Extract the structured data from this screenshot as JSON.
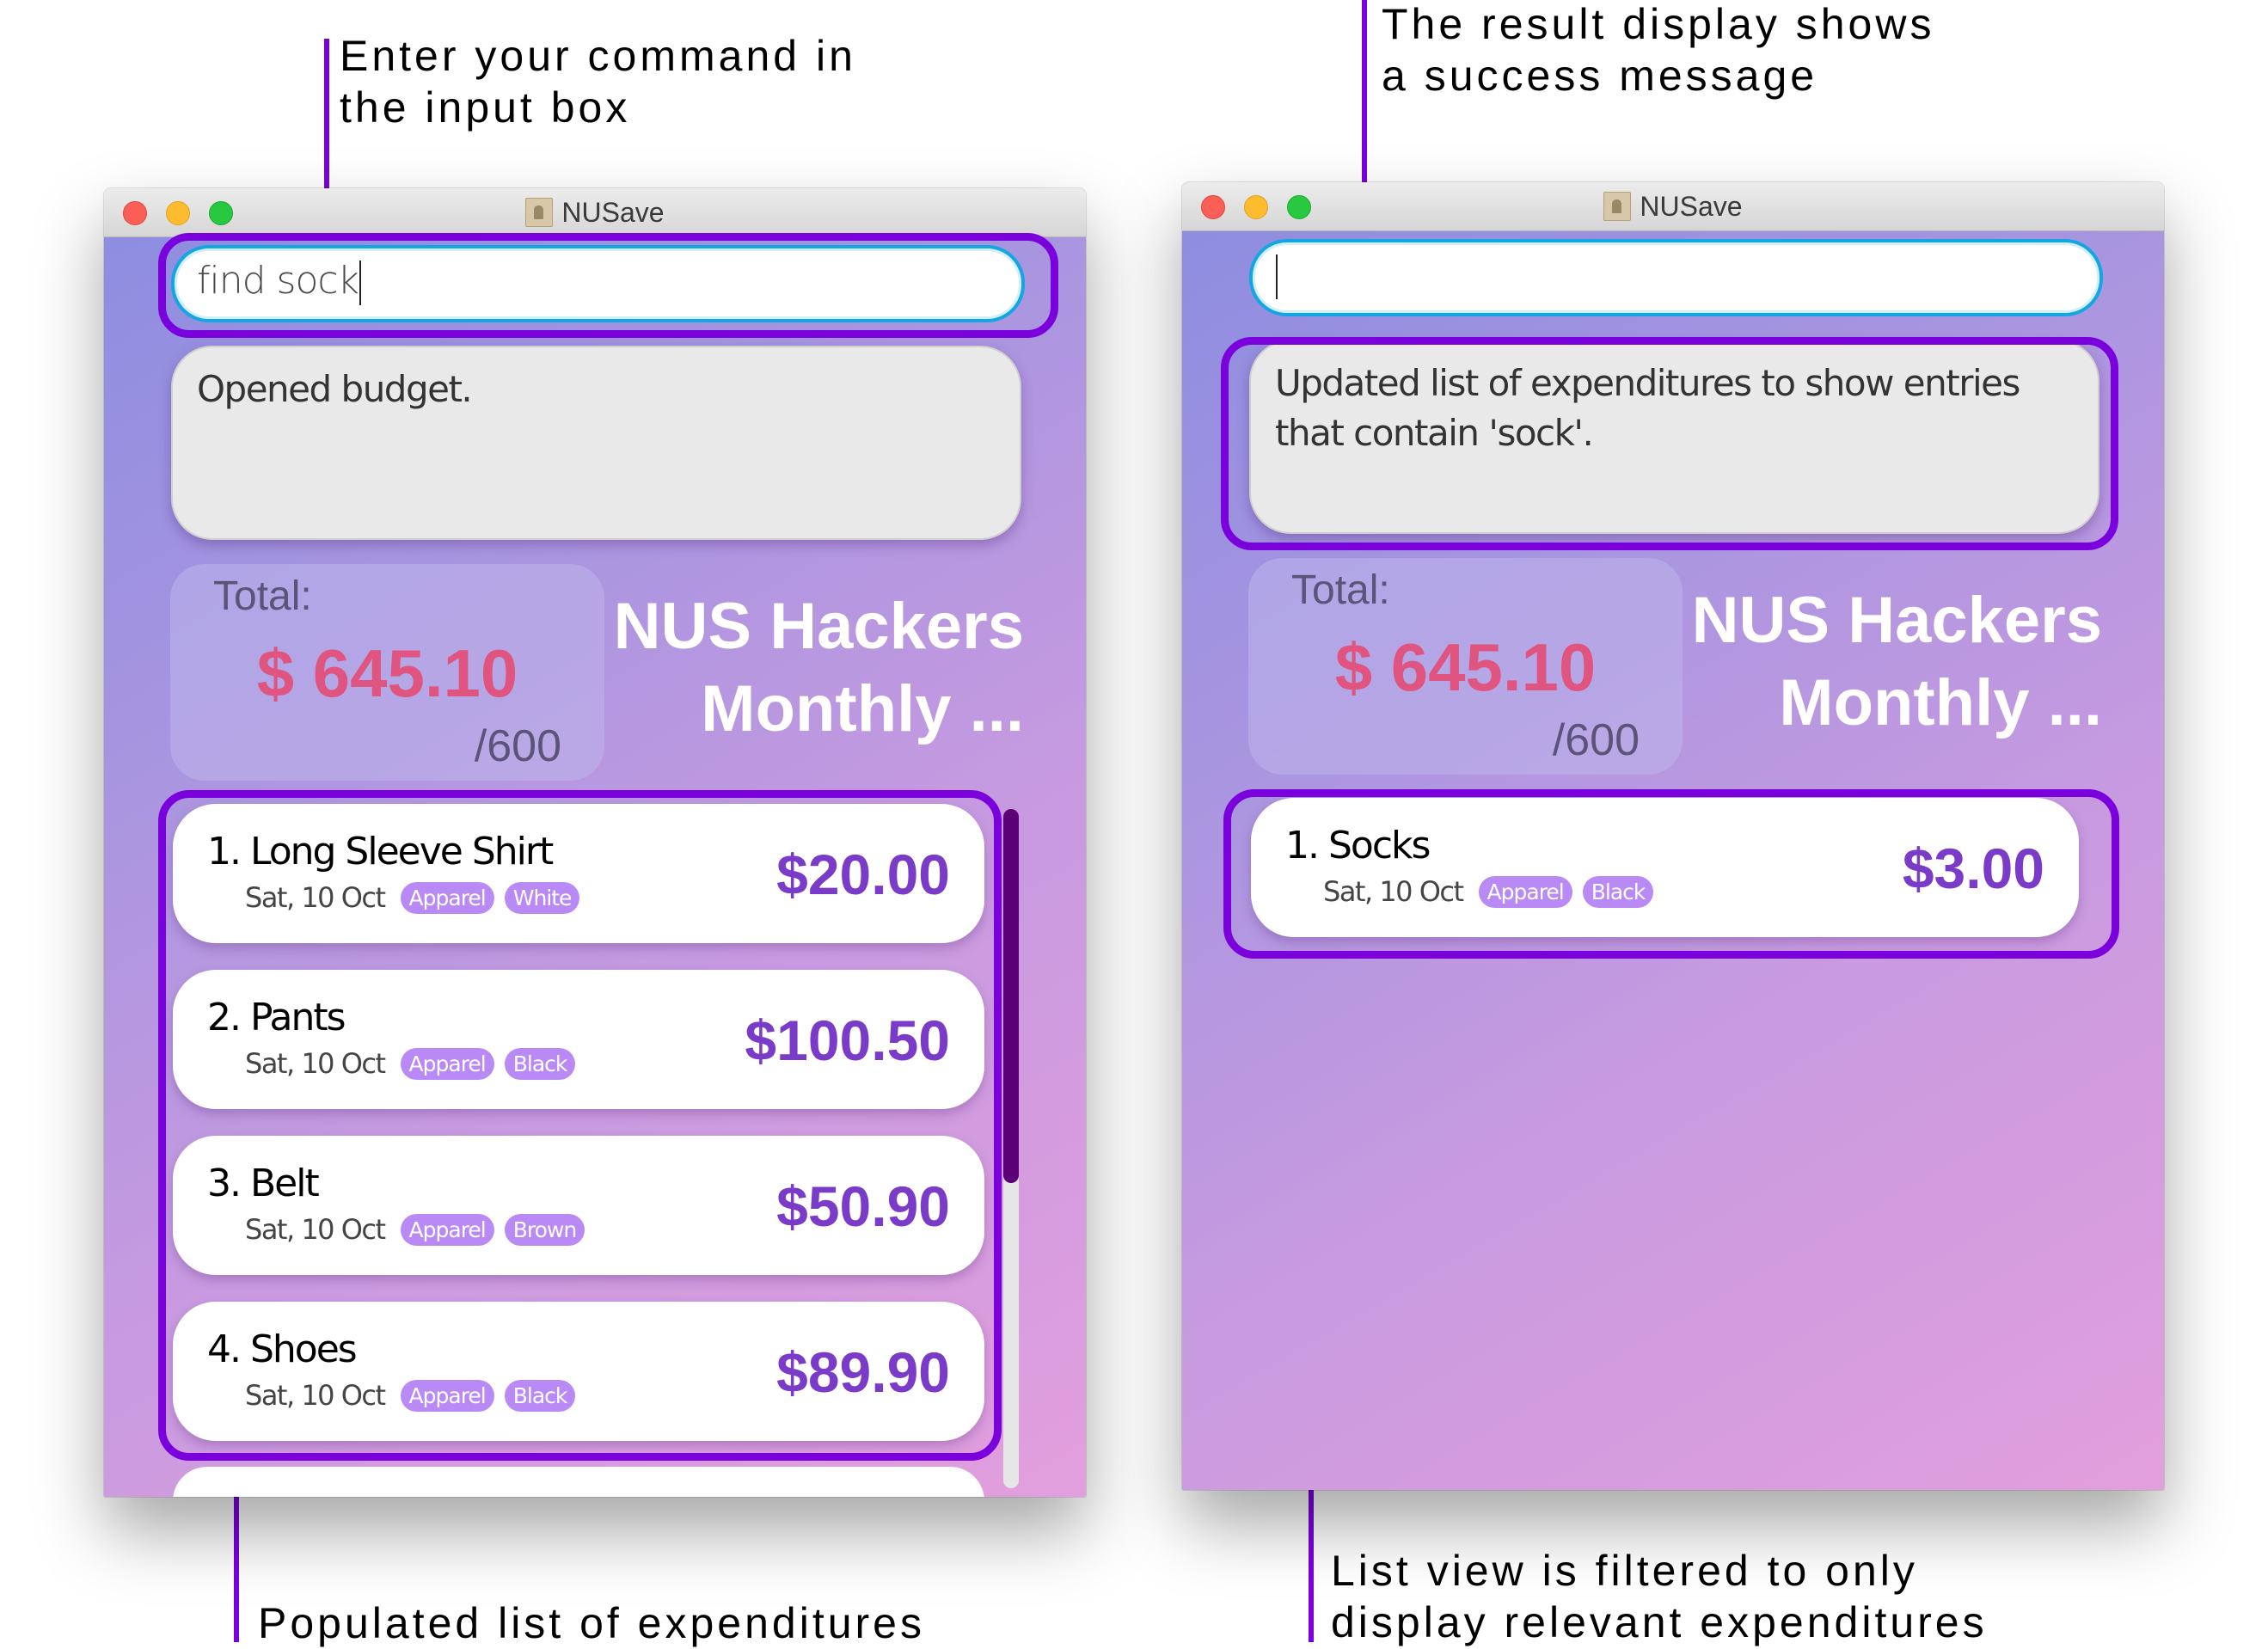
{
  "annotations": {
    "input_box": "Enter your command in\nthe input box",
    "result_display": "The result display shows\na success message",
    "populated_list": "Populated list of expenditures",
    "filtered_list": "List view is filtered to only\ndisplay relevant expenditures"
  },
  "colors": {
    "highlight": "#7a00dc",
    "amount": "#7a3cc8",
    "total": "#e0557f",
    "tag": "#b98af5",
    "scroll_thumb": "#5c0078"
  },
  "windows": [
    {
      "title": "NUSave",
      "title_icon": "document-icon",
      "command_input": {
        "value": "find sock",
        "placeholder": ""
      },
      "result_display": "Opened budget.",
      "total": {
        "label": "Total:",
        "amount": "$ 645.10",
        "budget": "/600"
      },
      "budget_name": "NUS Hackers\nMonthly ...",
      "scroll_position_fraction": 0,
      "scroll_visible_fraction": 0.55,
      "expenditures": [
        {
          "title": "1. Long Sleeve Shirt",
          "date": "Sat, 10 Oct",
          "tags": [
            "Apparel",
            "White"
          ],
          "amount": "$20.00"
        },
        {
          "title": "2. Pants",
          "date": "Sat, 10 Oct",
          "tags": [
            "Apparel",
            "Black"
          ],
          "amount": "$100.50"
        },
        {
          "title": "3. Belt",
          "date": "Sat, 10 Oct",
          "tags": [
            "Apparel",
            "Brown"
          ],
          "amount": "$50.90"
        },
        {
          "title": "4. Shoes",
          "date": "Sat, 10 Oct",
          "tags": [
            "Apparel",
            "Black"
          ],
          "amount": "$89.90"
        }
      ]
    },
    {
      "title": "NUSave",
      "title_icon": "document-icon",
      "command_input": {
        "value": "",
        "placeholder": ""
      },
      "result_display": "Updated list of expenditures to show entries that contain 'sock'.",
      "total": {
        "label": "Total:",
        "amount": "$ 645.10",
        "budget": "/600"
      },
      "budget_name": "NUS Hackers\nMonthly ...",
      "expenditures": [
        {
          "title": "1. Socks",
          "date": "Sat, 10 Oct",
          "tags": [
            "Apparel",
            "Black"
          ],
          "amount": "$3.00"
        }
      ]
    }
  ]
}
